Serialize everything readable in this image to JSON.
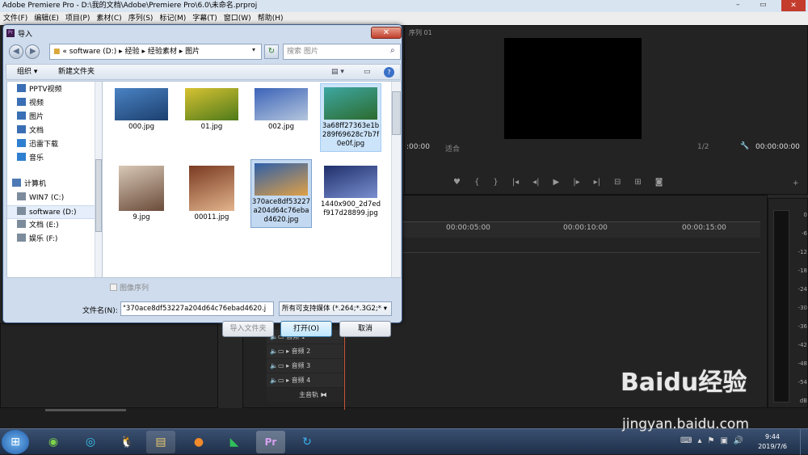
{
  "premiere": {
    "title": "Adobe Premiere Pro - D:\\我的文档\\Adobe\\Premiere Pro\\6.0\\未命名.prproj",
    "menu": [
      "文件(F)",
      "编辑(E)",
      "项目(P)",
      "素材(C)",
      "序列(S)",
      "标记(M)",
      "字幕(T)",
      "窗口(W)",
      "帮助(H)"
    ],
    "seq_tab": "序列 01",
    "tc_left": ":00:00",
    "fit": "适合",
    "ratio": "1/2",
    "tc_right": "00:00:00:00",
    "ruler": [
      "00:00:05:00",
      "00:00:10:00",
      "00:00:15:00"
    ],
    "tracks": [
      "音频 1",
      "音频 2",
      "音频 3",
      "音频 4",
      "主音轨"
    ],
    "meter_scale": [
      "0",
      "-6",
      "-12",
      "-18",
      "-24",
      "-30",
      "-36",
      "-42",
      "-48",
      "-54",
      "dB"
    ]
  },
  "dialog": {
    "title": "导入",
    "close": "✕",
    "address": [
      "«",
      "software (D:)",
      "▸",
      "经验",
      "▸",
      "经验素材",
      "▸",
      "图片"
    ],
    "search_placeholder": "搜索 图片",
    "organize": "组织 ▾",
    "new_folder": "新建文件夹",
    "nav": [
      {
        "label": "PPTV视频",
        "icon": "folder-icon",
        "color": "#3a6fb5"
      },
      {
        "label": "视频",
        "icon": "video-icon",
        "color": "#3a6fb5"
      },
      {
        "label": "图片",
        "icon": "pictures-icon",
        "color": "#3a6fb5"
      },
      {
        "label": "文档",
        "icon": "documents-icon",
        "color": "#3a6fb5"
      },
      {
        "label": "迅雷下载",
        "icon": "download-icon",
        "color": "#2f7fd0"
      },
      {
        "label": "音乐",
        "icon": "music-icon",
        "color": "#2f7fd0"
      },
      {
        "label": "计算机",
        "icon": "computer-icon",
        "color": "#4d7ab5"
      },
      {
        "label": "WIN7 (C:)",
        "icon": "drive-icon",
        "color": "#7d8c9c"
      },
      {
        "label": "software (D:)",
        "icon": "drive-icon",
        "color": "#7d8c9c"
      },
      {
        "label": "文档 (E:)",
        "icon": "drive-icon",
        "color": "#7d8c9c"
      },
      {
        "label": "娱乐 (F:)",
        "icon": "drive-icon",
        "color": "#7d8c9c"
      }
    ],
    "files": [
      {
        "name": "000.jpg",
        "colors": [
          "#4a83c4",
          "#1c3f6e"
        ]
      },
      {
        "name": "01.jpg",
        "colors": [
          "#d7c232",
          "#4e7a1a"
        ]
      },
      {
        "name": "002.jpg",
        "colors": [
          "#3b63b8",
          "#b5c6dd"
        ]
      },
      {
        "name": "3a68ff27363e1b289f69628c7b7f0e0f.jpg",
        "colors": [
          "#3ea7a2",
          "#2c6b2e"
        ]
      },
      {
        "name": "9.jpg",
        "colors": [
          "#d8c8b6",
          "#6b4b3a"
        ]
      },
      {
        "name": "00011.jpg",
        "colors": [
          "#7a3a22",
          "#e2b48c"
        ]
      },
      {
        "name": "370ace8df53227a204d64c76ebad4620.jpg",
        "colors": [
          "#2e5fa8",
          "#e0a046"
        ]
      },
      {
        "name": "1440x900_2d7edf917d28899.jpg",
        "colors": [
          "#1f2f6b",
          "#7a8fd0"
        ]
      }
    ],
    "sequence_label": "图像序列",
    "filename_label": "文件名(N):",
    "filename_value": "\"370ace8df53227a204d64c76ebad4620.j",
    "filetype_value": "所有可支持媒体 (*.264;*.3G2;* ▾",
    "import_folder": "导入文件夹",
    "open": "打开(O)",
    "cancel": "取消"
  },
  "taskbar": {
    "time": "9:44",
    "date": "2019/7/6"
  },
  "watermark": {
    "logo": "Baidu经验",
    "url": "jingyan.baidu.com"
  }
}
